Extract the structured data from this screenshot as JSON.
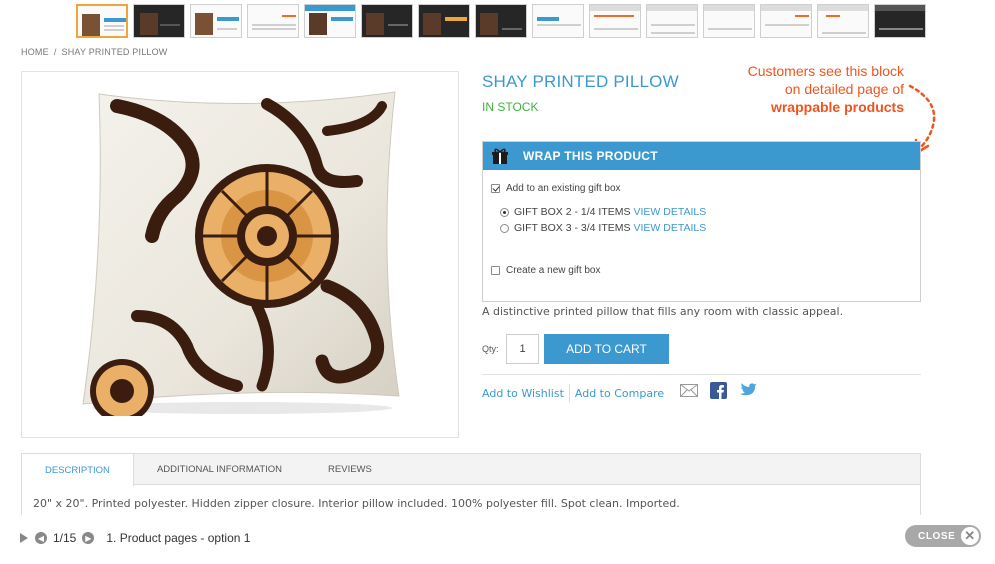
{
  "breadcrumb": {
    "home": "HOME",
    "separator": "/",
    "current": "SHAY PRINTED PILLOW"
  },
  "product": {
    "name": "SHAY PRINTED PILLOW",
    "stock": "IN STOCK",
    "description": "A distinctive printed pillow that fills any room with classic appeal."
  },
  "callout": {
    "line1": "Customers see this block",
    "line2": "on detailed page of",
    "line3": "wrappable products"
  },
  "wrap": {
    "title": "WRAP THIS PRODUCT",
    "existing_label": "Add to an existing gift box",
    "boxes": [
      {
        "label": "GIFT BOX 2 - 1/4 ITEMS",
        "link": "VIEW DETAILS",
        "selected": true
      },
      {
        "label": "GIFT BOX 3 - 3/4 ITEMS",
        "link": "VIEW DETAILS",
        "selected": false
      }
    ],
    "new_label": "Create a new gift box"
  },
  "cart": {
    "qty_label": "Qty:",
    "qty_value": "1",
    "button": "ADD TO CART"
  },
  "actions": {
    "wishlist": "Add to Wishlist",
    "compare": "Add to Compare"
  },
  "tabs": {
    "items": [
      "DESCRIPTION",
      "ADDITIONAL INFORMATION",
      "REVIEWS"
    ],
    "content": "20\" x 20\". Printed polyester. Hidden zipper closure. Interior pillow included. 100% polyester fill. Spot clean. Imported."
  },
  "slideshow": {
    "counter": "1/15",
    "title": "1. Product pages - option 1",
    "close": "CLOSE"
  },
  "colors": {
    "accent": "#3c99d0",
    "stock": "#3db33d",
    "callout": "#f0541e"
  },
  "icons": [
    "gift-icon",
    "mail-icon",
    "facebook-icon",
    "twitter-icon",
    "play-icon",
    "prev-icon",
    "next-icon",
    "close-icon"
  ]
}
